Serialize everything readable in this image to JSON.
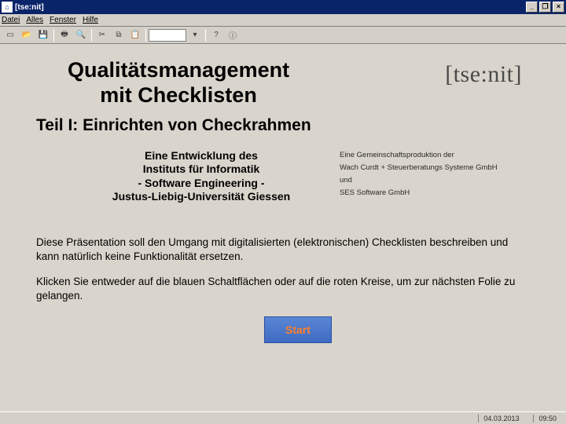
{
  "window": {
    "title": "[tse:nit]",
    "minimize": "_",
    "restore": "❐",
    "close": "×"
  },
  "menu": {
    "file": "Datei",
    "misc": "Alles",
    "window": "Fenster",
    "help": "Hilfe"
  },
  "toolbar": {
    "zoom": ""
  },
  "slide": {
    "title_l1": "Qualitätsmanagement",
    "title_l2": "mit Checklisten",
    "logo": "[tse:nit]",
    "subtitle": "Teil I: Einrichten von Checkrahmen",
    "credit_left_l1": "Eine Entwicklung des",
    "credit_left_l2": "Instituts für Informatik",
    "credit_left_l3": "- Software Engineering -",
    "credit_left_l4": "Justus-Liebig-Universität Giessen",
    "credit_right_l1": "Eine Gemeinschaftsproduktion der",
    "credit_right_l2": "Wach Curdt + Steuerberatungs Systeme GmbH",
    "credit_right_l3": "und",
    "credit_right_l4": "SES Software GmbH",
    "intro1": "Diese Präsentation soll den Umgang mit digitalisierten (elektronischen) Checklisten beschreiben und kann natürlich keine Funktionalität ersetzen.",
    "intro2": "Klicken Sie entweder auf die blauen Schaltflächen oder auf die roten Kreise, um zur nächsten Folie zu gelangen.",
    "start": "Start"
  },
  "status": {
    "date": "04.03.2013",
    "time": "09:50"
  }
}
